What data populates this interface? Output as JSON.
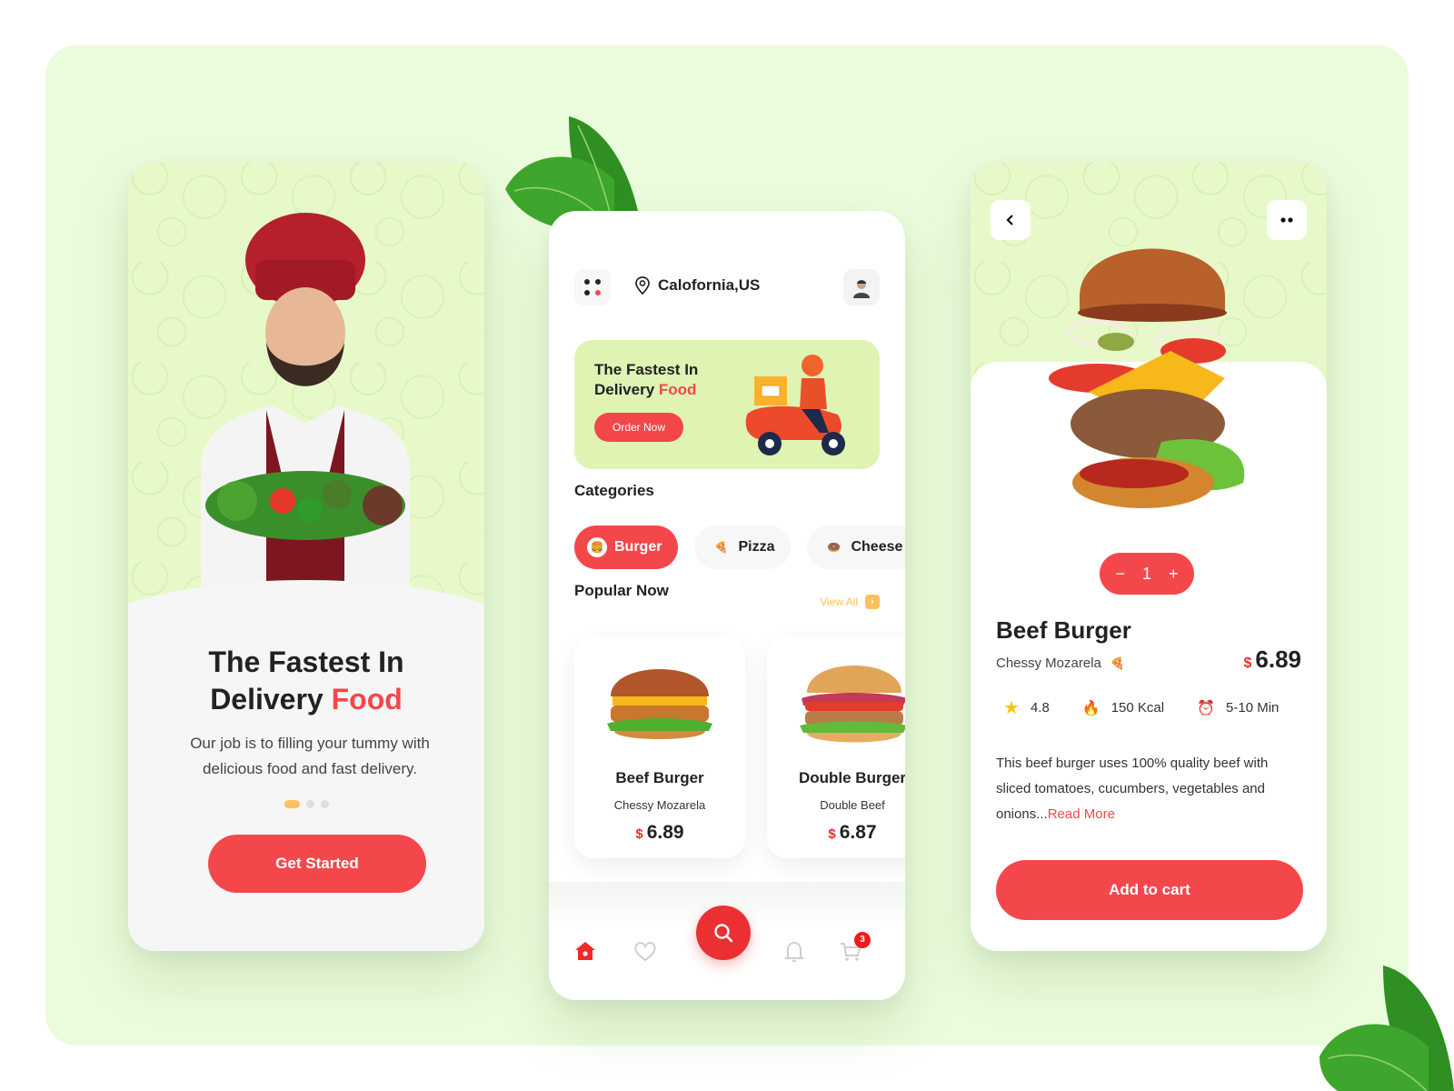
{
  "colors": {
    "accent_red": "#f4474b",
    "accent_yellow": "#fcc15b",
    "panel_green": "#ebfcdc",
    "pattern_green": "#e7f9c9",
    "text_dark": "#222222"
  },
  "onboarding": {
    "title_line1": "The Fastest In",
    "title_line2_prefix": "Delivery ",
    "title_line2_accent": "Food",
    "subtitle": "Our job is to filling your tummy with delicious food and fast delivery.",
    "page_indicator": {
      "current": 1,
      "total": 3
    },
    "cta_label": "Get Started"
  },
  "home": {
    "location": "Calofornia,US",
    "banner": {
      "title_line1": "The Fastest In",
      "title_line2_prefix": "Delivery ",
      "title_line2_accent": "Food",
      "button_label": "Order Now"
    },
    "categories_title": "Categories",
    "categories": [
      {
        "label": "Burger",
        "icon": "burger-icon",
        "active": true
      },
      {
        "label": "Pizza",
        "icon": "pizza-icon",
        "active": false
      },
      {
        "label": "Cheese",
        "icon": "donut-icon",
        "active": false
      }
    ],
    "popular_title": "Popular Now",
    "view_all_label": "View All",
    "popular": [
      {
        "name": "Beef Burger",
        "desc": "Chessy Mozarela",
        "currency": "$",
        "price": "6.89"
      },
      {
        "name": "Double Burger",
        "desc": "Double Beef",
        "currency": "$",
        "price": "6.87"
      }
    ],
    "nav": {
      "items": [
        "home-icon",
        "heart-icon",
        "search-icon",
        "bell-icon",
        "cart-icon"
      ],
      "active": "home-icon",
      "cart_badge": "3"
    }
  },
  "detail": {
    "quantity": "1",
    "name": "Beef Burger",
    "subtitle": "Chessy Mozarela",
    "currency": "$",
    "price": "6.89",
    "stats": [
      {
        "icon": "star-icon",
        "value": "4.8"
      },
      {
        "icon": "fire-icon",
        "value": "150 Kcal"
      },
      {
        "icon": "alarm-clock-icon",
        "value": "5-10 Min"
      }
    ],
    "description": "This beef burger uses 100% quality beef with sliced tomatoes, cucumbers, vegetables and onions...",
    "read_more_label": "Read More",
    "cta_label": "Add to cart"
  }
}
